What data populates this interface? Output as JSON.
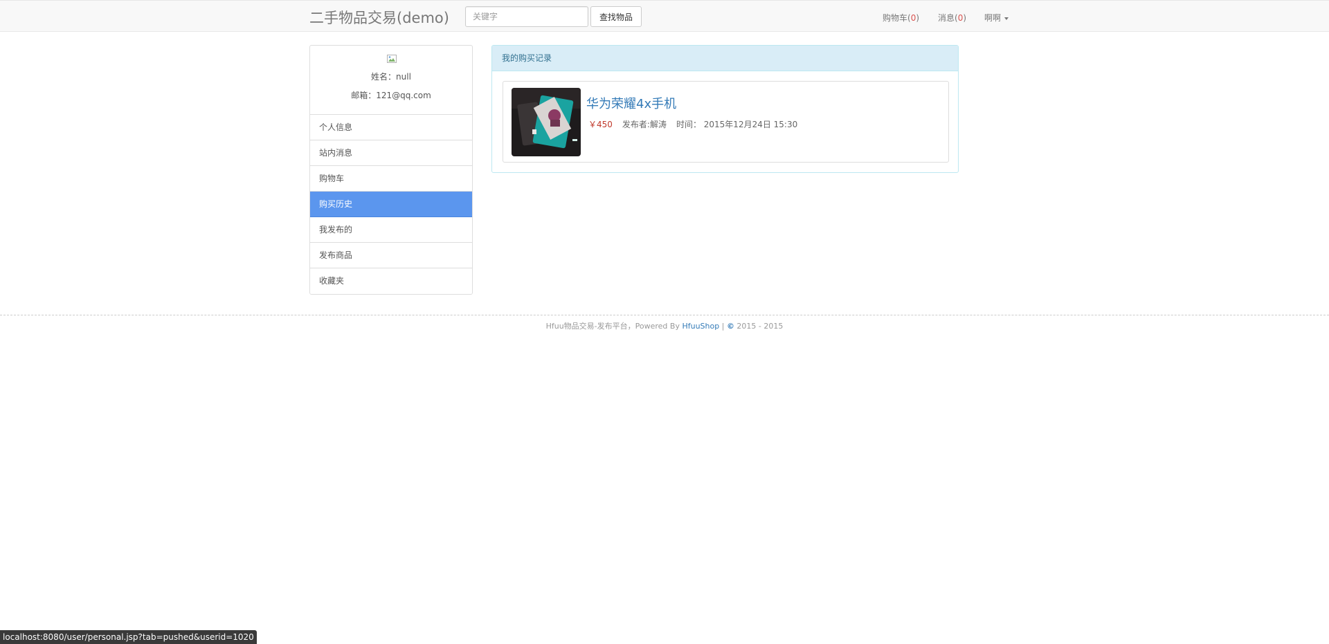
{
  "navbar": {
    "brand": "二手物品交易(demo)",
    "search_placeholder": "关键字",
    "search_button": "查找物品",
    "cart_label": "购物车(",
    "cart_count": "0",
    "messages_label": "消息(",
    "messages_count": "0",
    "close_paren": ")",
    "user_menu": "啊啊"
  },
  "profile": {
    "name": "姓名：null",
    "email": "邮箱：121@qq.com"
  },
  "sidebar": {
    "items": [
      {
        "label": "个人信息"
      },
      {
        "label": "站内消息"
      },
      {
        "label": "购物车"
      },
      {
        "label": "购买历史",
        "active": true
      },
      {
        "label": "我发布的"
      },
      {
        "label": "发布商品"
      },
      {
        "label": "收藏夹"
      }
    ]
  },
  "panel": {
    "heading": "我的购买记录",
    "items": [
      {
        "title": "华为荣耀4x手机",
        "price": "￥450",
        "publisher": "发布者:解涛",
        "time": "时间： 2015年12月24日 15:30"
      }
    ]
  },
  "footer": {
    "text": "Hfuu物品交易-发布平台，Powered By ",
    "link": "HfuuShop",
    "separator": " | ",
    "copyright_symbol": "©",
    "years": " 2015 - 2015"
  },
  "status_bar": {
    "url": "localhost:8080/user/personal.jsp?tab=pushed&userid=1020"
  },
  "colors": {
    "accent": "#5b96ee",
    "link": "#337ab7",
    "price": "#c0392b",
    "panel_heading_bg": "#d9edf7"
  }
}
